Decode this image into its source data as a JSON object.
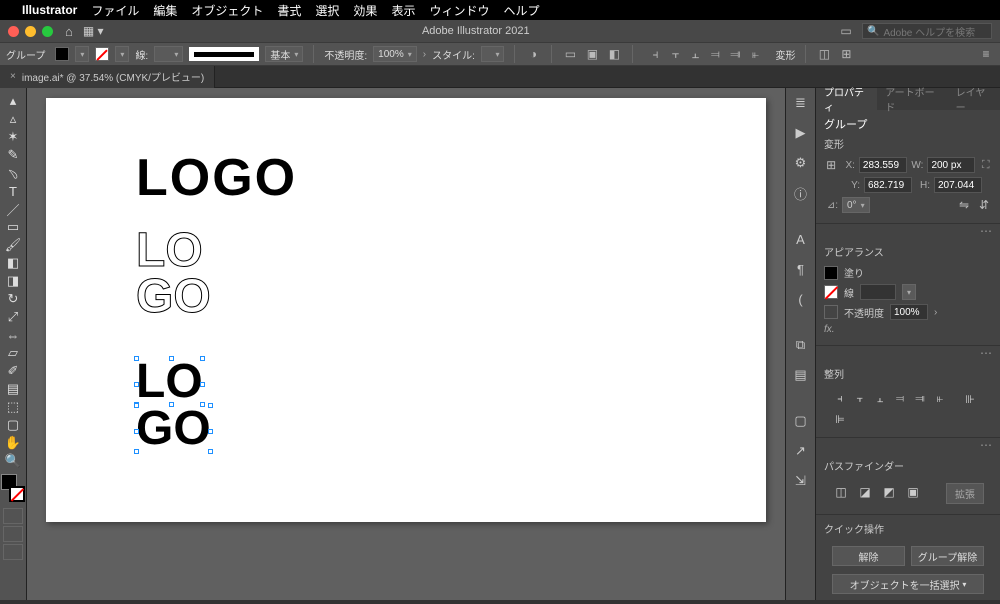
{
  "menubar": {
    "app": "Illustrator",
    "items": [
      "ファイル",
      "編集",
      "オブジェクト",
      "書式",
      "選択",
      "効果",
      "表示",
      "ウィンドウ",
      "ヘルプ"
    ]
  },
  "titlebar": {
    "title": "Adobe Illustrator 2021",
    "search_placeholder": "Adobe ヘルプを検索"
  },
  "ctrlbar": {
    "selection_label": "グループ",
    "stroke_label": "線:",
    "stroke_profile": "基本",
    "opacity_label": "不透明度:",
    "opacity_value": "100%",
    "style_label": "スタイル:",
    "transform_label": "変形"
  },
  "tab": {
    "close": "×",
    "name": "image.ai* @ 37.54% (CMYK/プレビュー)"
  },
  "canvas": {
    "logo1": "LOGO",
    "logo2a": "LO",
    "logo2b": "GO",
    "logo3a": "LO",
    "logo3b": "GO"
  },
  "rightcol_icons": [
    "props",
    "play",
    "gear",
    "info",
    "type",
    "para",
    "brush",
    "link",
    "lib",
    "out",
    "out2"
  ],
  "panel": {
    "tabs": {
      "properties": "プロパティ",
      "artboard": "アートボード",
      "layers": "レイヤー"
    },
    "selection_title": "グループ",
    "transform": {
      "heading": "変形",
      "x_label": "X:",
      "x": "283.559",
      "y_label": "Y:",
      "y": "682.719",
      "w_label": "W:",
      "w": "200 px",
      "h_label": "H:",
      "h": "207.044",
      "angle_label": "⊿:",
      "angle": "0°"
    },
    "appearance": {
      "heading": "アピアランス",
      "fill_label": "塗り",
      "stroke_label": "線",
      "opacity_label": "不透明度",
      "opacity_value": "100%",
      "fx": "fx."
    },
    "align": {
      "heading": "整列"
    },
    "pathfinder": {
      "heading": "パスファインダー",
      "expand": "拡張"
    },
    "quick": {
      "heading": "クイック操作",
      "ungroup": "解除",
      "group_release": "グループ解除",
      "select_all": "オブジェクトを一括選択"
    }
  }
}
